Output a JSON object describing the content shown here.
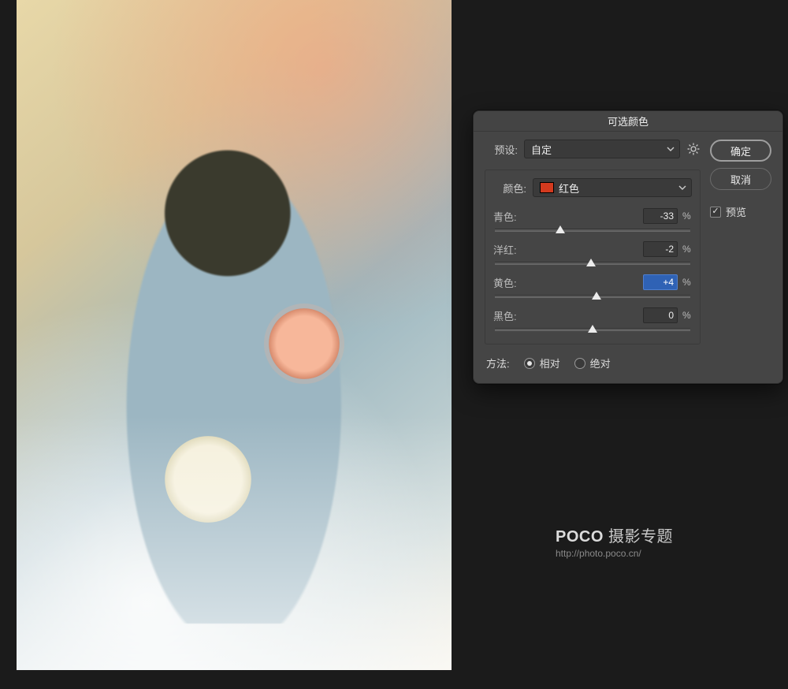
{
  "panel": {
    "title": "可选颜色",
    "preset_label": "预设:",
    "preset_value": "自定",
    "color_label": "颜色:",
    "color_value": "红色",
    "color_swatch": "#d33a1e",
    "sliders": {
      "cyan": {
        "label": "青色:",
        "value": "-33",
        "percent": "%",
        "pos": 33.5
      },
      "magenta": {
        "label": "洋红:",
        "value": "-2",
        "percent": "%",
        "pos": 49.0
      },
      "yellow": {
        "label": "黄色:",
        "value": "+4",
        "percent": "%",
        "pos": 52.0,
        "active": true
      },
      "black": {
        "label": "黑色:",
        "value": "0",
        "percent": "%",
        "pos": 50.0
      }
    },
    "method_label": "方法:",
    "method_relative": "相对",
    "method_absolute": "绝对",
    "method_selected": "relative",
    "ok_label": "确定",
    "cancel_label": "取消",
    "preview_label": "预览",
    "preview_checked": true
  },
  "watermark": {
    "brand_prefix": "POCO",
    "brand_suffix": " 摄影专题",
    "url": "http://photo.poco.cn/"
  }
}
